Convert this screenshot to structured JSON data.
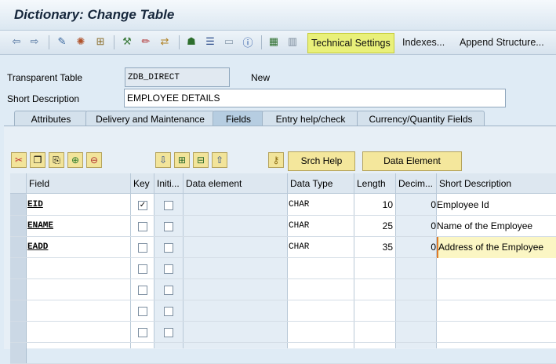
{
  "window": {
    "title": "Dictionary: Change Table"
  },
  "toolbar": {
    "technical_settings": "Technical Settings",
    "indexes": "Indexes...",
    "append_structure": "Append Structure..."
  },
  "header": {
    "table_type_label": "Transparent Table",
    "table_name": "ZDB_DIRECT",
    "status": "New",
    "short_desc_label": "Short Description",
    "short_desc": "EMPLOYEE DETAILS"
  },
  "tabs": [
    "Attributes",
    "Delivery and Maintenance",
    "Fields",
    "Entry help/check",
    "Currency/Quantity Fields"
  ],
  "active_tab": "Fields",
  "buttons": {
    "srch_help": "Srch Help",
    "data_element": "Data Element"
  },
  "columns": [
    "Field",
    "Key",
    "Initi...",
    "Data element",
    "Data Type",
    "Length",
    "Decim...",
    "Short Description"
  ],
  "rows": [
    {
      "field": "EID",
      "key": true,
      "init": false,
      "data_element": "",
      "data_type": "CHAR",
      "length": "10",
      "decimals": "0",
      "desc": "Employee Id"
    },
    {
      "field": "ENAME",
      "key": false,
      "init": false,
      "data_element": "",
      "data_type": "CHAR",
      "length": "25",
      "decimals": "0",
      "desc": "Name of the Employee"
    },
    {
      "field": "EADD",
      "key": false,
      "init": false,
      "data_element": "",
      "data_type": "CHAR",
      "length": "35",
      "decimals": "0",
      "desc": "Address of the Employee"
    }
  ],
  "colors": {
    "highlight": "#e9f07a",
    "yellow_button": "#f4e79c",
    "background": "#dfebf5"
  }
}
